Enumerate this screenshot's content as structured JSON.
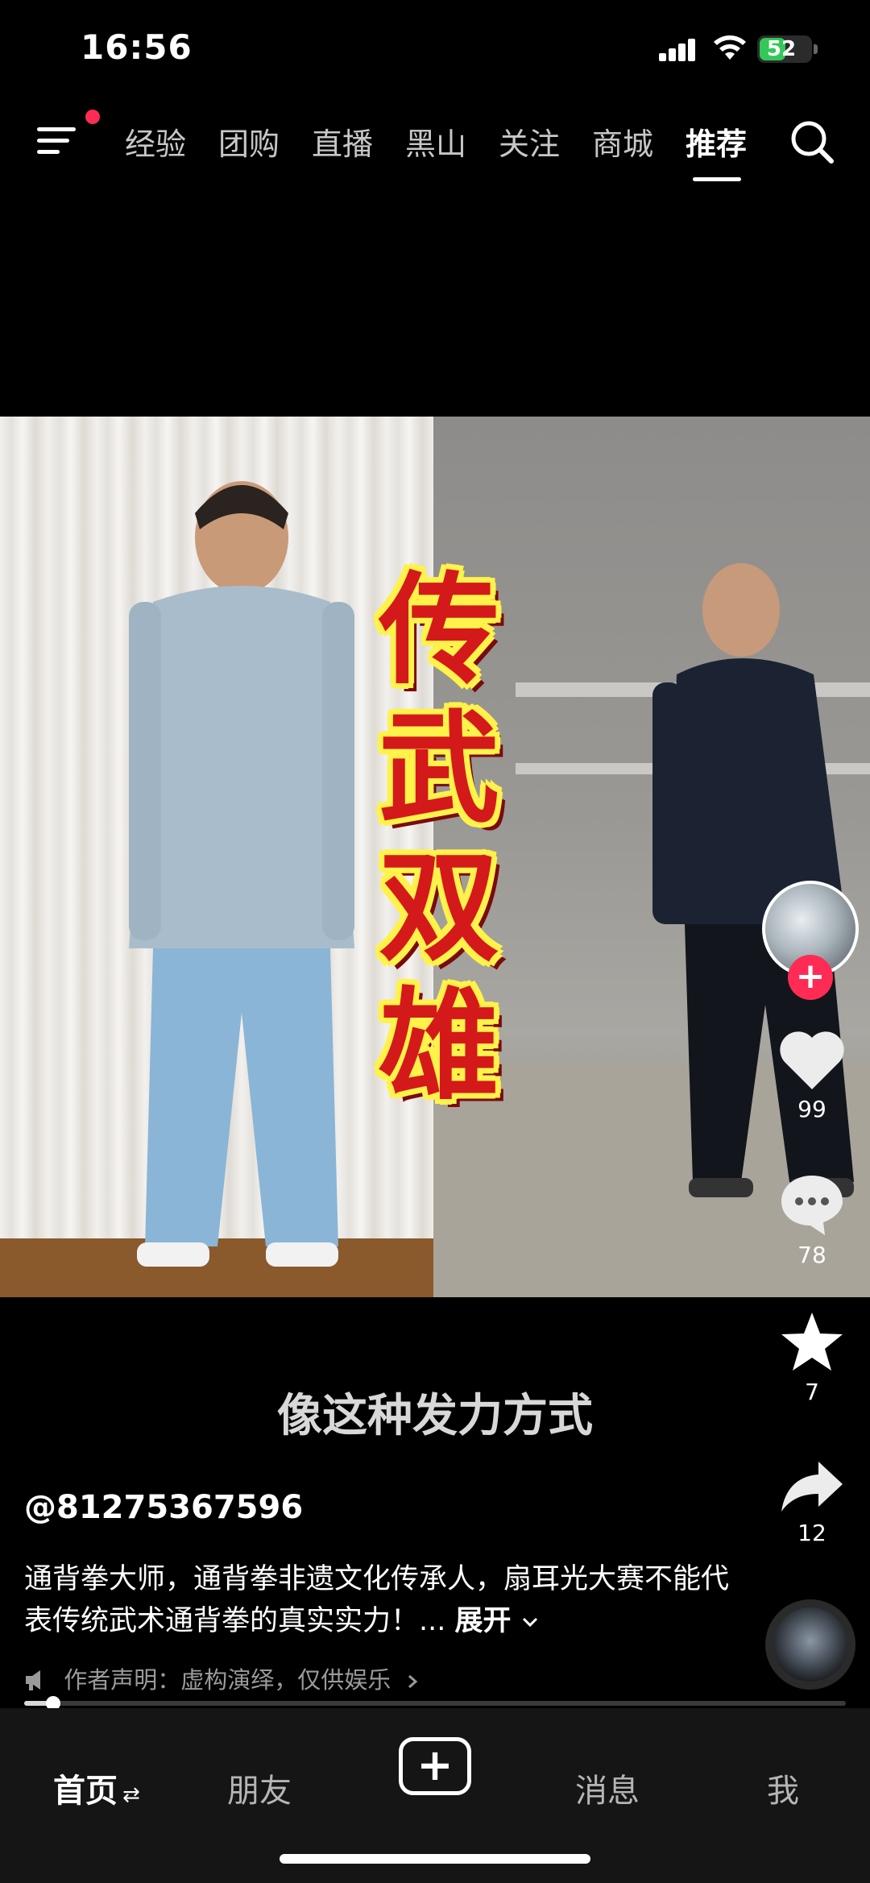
{
  "status_bar": {
    "time": "16:56",
    "battery": "52",
    "battery_level": 0.52,
    "accent_battery": "#34c759"
  },
  "top_nav": {
    "has_notification": true,
    "tabs": [
      {
        "label": "经验",
        "active": false
      },
      {
        "label": "团购",
        "active": false
      },
      {
        "label": "直播",
        "active": false
      },
      {
        "label": "黑山",
        "active": false
      },
      {
        "label": "关注",
        "active": false
      },
      {
        "label": "商城",
        "active": false
      },
      {
        "label": "推荐",
        "active": true
      }
    ],
    "icons": [
      "menu-icon",
      "search-icon"
    ]
  },
  "video": {
    "overlay_title": [
      "传",
      "武",
      "双",
      "雄"
    ],
    "subtitle": "像这种发力方式"
  },
  "actions": {
    "like_count": "99",
    "comment_count": "78",
    "favorite_count": "7",
    "share_count": "12",
    "follow_symbol": "+",
    "colors": {
      "follow": "#fe2c55"
    }
  },
  "post": {
    "username": "@81275367596",
    "description": "通背拳大师，通背拳非遗文化传承人，扇耳光大赛不能代表传统武术通背拳的真实实力！...",
    "expand_label": "展开",
    "disclaimer": "作者声明：虚构演绎，仅供娱乐"
  },
  "progress": {
    "value": 0.035
  },
  "bottom_tabs": {
    "home": "首页",
    "home_switch": "⇄",
    "friends": "朋友",
    "create": "+",
    "messages": "消息",
    "me": "我"
  }
}
